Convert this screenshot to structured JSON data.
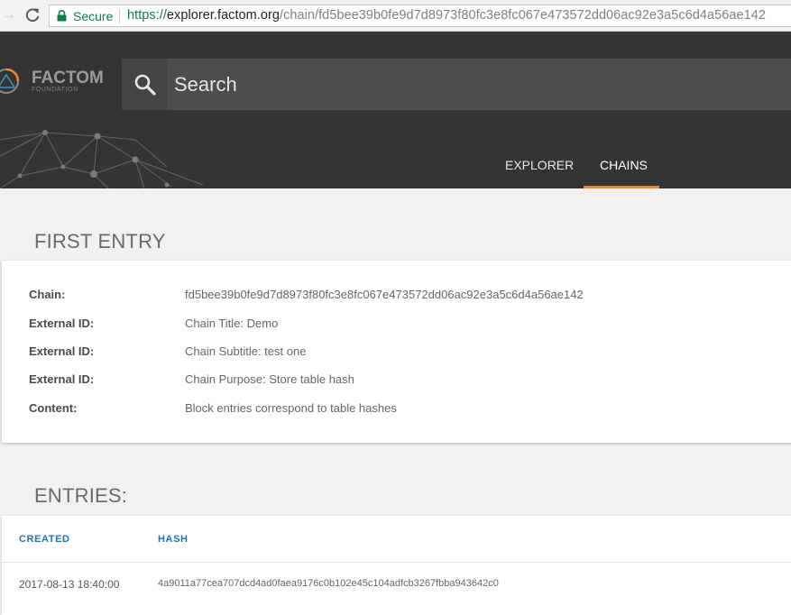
{
  "browser": {
    "security_label": "Secure",
    "url_scheme": "https://",
    "url_host": "explorer.factom.org",
    "url_path": "/chain/fd5bee39b0fe9d7d8973f80fc3e8fc067e473572dd06ac92e3a5c6d4a56ae142"
  },
  "header": {
    "logo_text": "FACTOM",
    "logo_subtext": "FOUNDATION",
    "search_placeholder": "Search",
    "tabs": [
      {
        "label": "EXPLORER",
        "active": false
      },
      {
        "label": "CHAINS",
        "active": true
      }
    ],
    "accent_color": "#e98b2e"
  },
  "first_entry": {
    "title": "FIRST ENTRY",
    "rows": [
      {
        "label": "Chain:",
        "value": "fd5bee39b0fe9d7d8973f80fc3e8fc067e473572dd06ac92e3a5c6d4a56ae142"
      },
      {
        "label": "External ID:",
        "value": "Chain Title: Demo"
      },
      {
        "label": "External ID:",
        "value": "Chain Subtitle: test one"
      },
      {
        "label": "External ID:",
        "value": "Chain Purpose: Store table hash"
      },
      {
        "label": "Content:",
        "value": "Block entries correspond to table hashes"
      }
    ]
  },
  "entries": {
    "title": "ENTRIES:",
    "columns": [
      "CREATED",
      "HASH"
    ],
    "rows": [
      {
        "created": "2017-08-13 18:40:00",
        "hash": "4a9011a77cea707dcd4ad0faea9176c0b102e45c104adfcb3267fbba943642c0"
      }
    ]
  }
}
